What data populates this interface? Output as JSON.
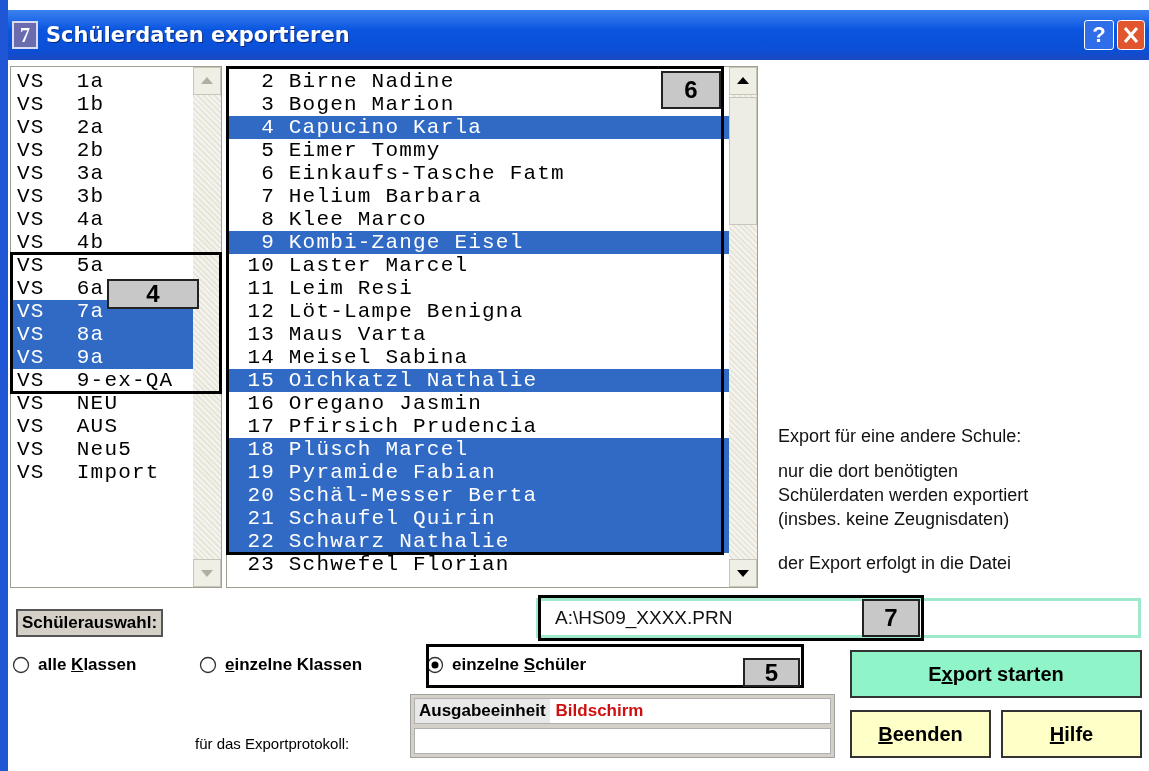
{
  "window": {
    "icon_label": "7",
    "title": "Schülerdaten exportieren",
    "help_label": "?"
  },
  "class_list": {
    "callout": "4",
    "items": [
      {
        "school": "VS",
        "class": "1a",
        "selected": false
      },
      {
        "school": "VS",
        "class": "1b",
        "selected": false
      },
      {
        "school": "VS",
        "class": "2a",
        "selected": false
      },
      {
        "school": "VS",
        "class": "2b",
        "selected": false
      },
      {
        "school": "VS",
        "class": "3a",
        "selected": false
      },
      {
        "school": "VS",
        "class": "3b",
        "selected": false
      },
      {
        "school": "VS",
        "class": "4a",
        "selected": false
      },
      {
        "school": "VS",
        "class": "4b",
        "selected": false
      },
      {
        "school": "VS",
        "class": "5a",
        "selected": false
      },
      {
        "school": "VS",
        "class": "6a",
        "selected": false
      },
      {
        "school": "VS",
        "class": "7a",
        "selected": true
      },
      {
        "school": "VS",
        "class": "8a",
        "selected": true
      },
      {
        "school": "VS",
        "class": "9a",
        "selected": true
      },
      {
        "school": "VS",
        "class": "9-ex-QA",
        "selected": false
      },
      {
        "school": "VS",
        "class": "NEU",
        "selected": false
      },
      {
        "school": "VS",
        "class": "AUS",
        "selected": false
      },
      {
        "school": "VS",
        "class": "Neu5",
        "selected": false
      },
      {
        "school": "VS",
        "class": "Import",
        "selected": false
      }
    ]
  },
  "student_list": {
    "callout": "6",
    "items": [
      {
        "number": "2",
        "name": "Birne Nadine",
        "selected": false
      },
      {
        "number": "3",
        "name": "Bogen Marion",
        "selected": false
      },
      {
        "number": "4",
        "name": "Capucino Karla",
        "selected": true
      },
      {
        "number": "5",
        "name": "Eimer Tommy",
        "selected": false
      },
      {
        "number": "6",
        "name": "Einkaufs-Tasche Fatm",
        "selected": false
      },
      {
        "number": "7",
        "name": "Helium Barbara",
        "selected": false
      },
      {
        "number": "8",
        "name": "Klee Marco",
        "selected": false
      },
      {
        "number": "9",
        "name": "Kombi-Zange Eisel",
        "selected": true
      },
      {
        "number": "10",
        "name": "Laster Marcel",
        "selected": false
      },
      {
        "number": "11",
        "name": "Leim Resi",
        "selected": false
      },
      {
        "number": "12",
        "name": "Löt-Lampe Benigna",
        "selected": false
      },
      {
        "number": "13",
        "name": "Maus Varta",
        "selected": false
      },
      {
        "number": "14",
        "name": "Meisel Sabina",
        "selected": false
      },
      {
        "number": "15",
        "name": "Oichkatzl Nathalie",
        "selected": true
      },
      {
        "number": "16",
        "name": "Oregano Jasmin",
        "selected": false
      },
      {
        "number": "17",
        "name": "Pfirsich Prudencia",
        "selected": false
      },
      {
        "number": "18",
        "name": "Plüsch Marcel",
        "selected": true
      },
      {
        "number": "19",
        "name": "Pyramide Fabian",
        "selected": true
      },
      {
        "number": "20",
        "name": "Schäl-Messer Berta",
        "selected": true
      },
      {
        "number": "21",
        "name": "Schaufel Quirin",
        "selected": true
      },
      {
        "number": "22",
        "name": "Schwarz Nathalie",
        "selected": true
      },
      {
        "number": "23",
        "name": "Schwefel Florian",
        "selected": false
      }
    ]
  },
  "info": {
    "heading": "Export für eine andere Schule:",
    "description": "nur die dort benötigten Schülerdaten werden exportiert (insbes. keine Zeugnisdaten)",
    "file_note": "der Export erfolgt in die Datei"
  },
  "selection_label": "Schülerauswahl:",
  "file_field": {
    "value": "A:\\HS09_XXXX.PRN",
    "callout": "7"
  },
  "radio_group": {
    "callout": "5",
    "options": [
      {
        "before": "alle ",
        "key": "K",
        "after": "lassen",
        "selected": false
      },
      {
        "key": "e",
        "after": "inzelne Klassen",
        "selected": false
      },
      {
        "before": "einzelne ",
        "key": "S",
        "after": "chüler",
        "selected": true
      }
    ]
  },
  "output": {
    "label": "Ausgabeeinheit",
    "value": "Bildschirm",
    "caption": "für das Exportprotokoll:"
  },
  "buttons": [
    {
      "kind": "primary",
      "before": "E",
      "key": "x",
      "after": "port starten"
    },
    {
      "kind": "normal",
      "key": "B",
      "after": "eenden"
    },
    {
      "kind": "normal",
      "key": "H",
      "after": "ilfe"
    }
  ]
}
